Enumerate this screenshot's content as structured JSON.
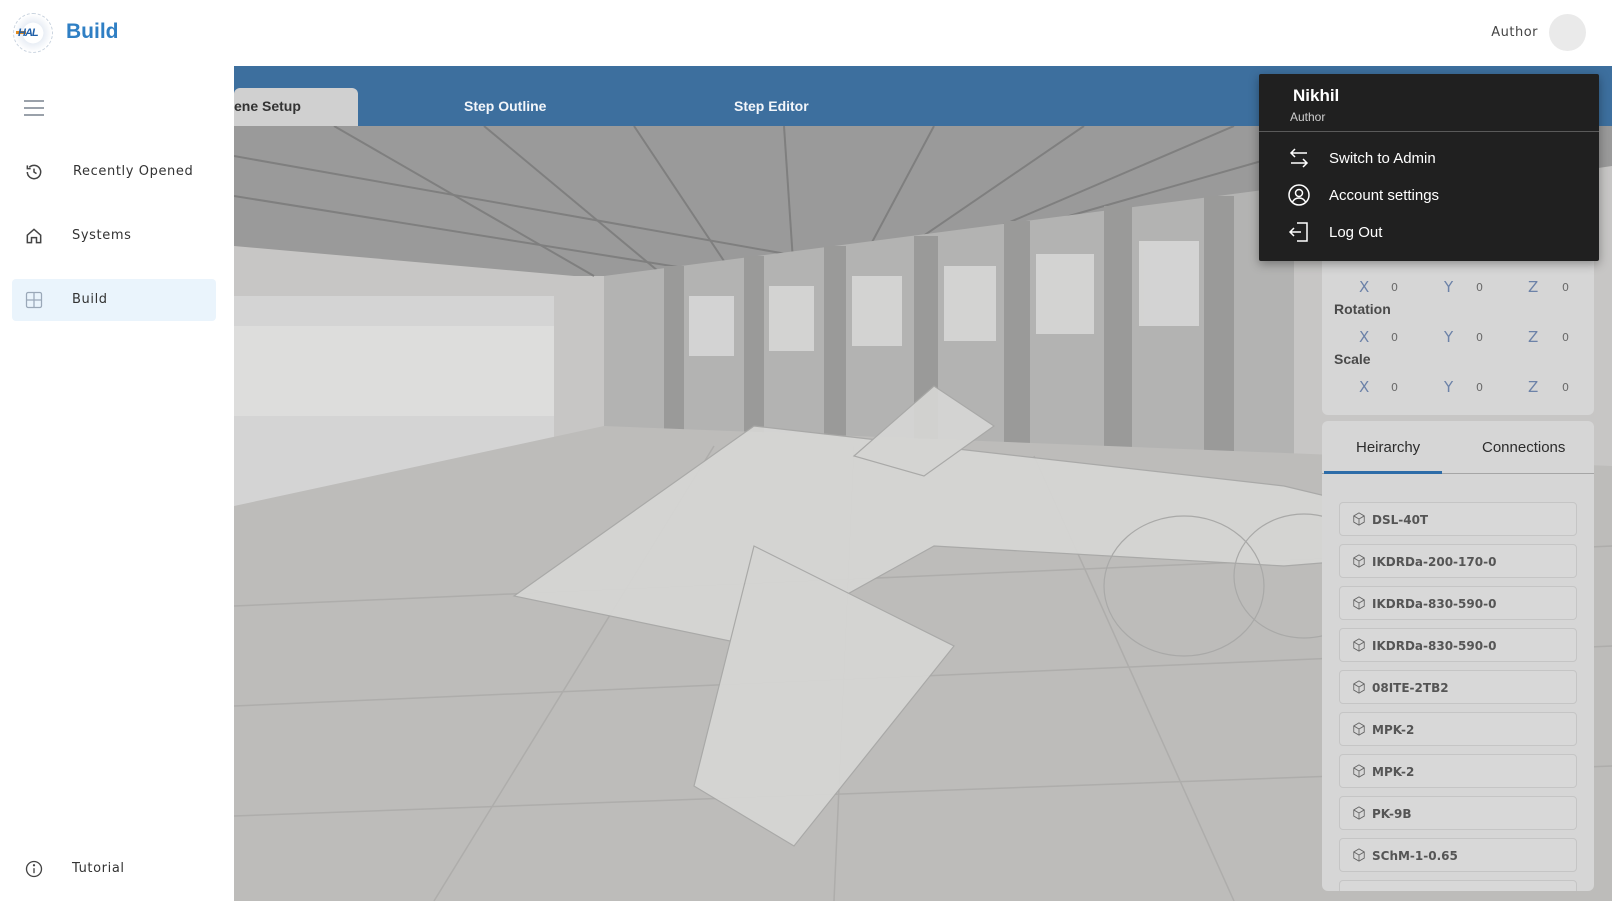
{
  "header": {
    "app_title": "Build",
    "role_label": "Author"
  },
  "sidebar": {
    "items": [
      {
        "label": "Recently Opened",
        "icon": "history-icon"
      },
      {
        "label": "Systems",
        "icon": "home-icon"
      },
      {
        "label": "Build",
        "icon": "grid-icon",
        "active": true
      }
    ],
    "footer_item": {
      "label": "Tutorial",
      "icon": "info-icon"
    }
  },
  "tabs": [
    {
      "label": "ene Setup",
      "active": true
    },
    {
      "label": "Step Outline"
    },
    {
      "label": "Step Editor"
    }
  ],
  "properties": {
    "sections": [
      {
        "label": "Rotation"
      },
      {
        "label": "Scale"
      }
    ],
    "axes": [
      "X",
      "Y",
      "Z"
    ],
    "values": {
      "position": [
        "0",
        "0",
        "0"
      ],
      "rotation": [
        "0",
        "0",
        "0"
      ],
      "scale": [
        "0",
        "0",
        "0"
      ]
    }
  },
  "hierarchy": {
    "tabs": [
      "Heirarchy",
      "Connections"
    ],
    "items": [
      "DSL-40T",
      "IKDRDa-200-170-0",
      "IKDRDa-830-590-0",
      "IKDRDa-830-590-0",
      "08ITE-2TB2",
      "MPK-2",
      "MPK-2",
      "PK-9B",
      "SChM-1-0.65"
    ]
  },
  "user_menu": {
    "name": "Nikhil",
    "role": "Author",
    "items": [
      {
        "label": "Switch to Admin",
        "icon": "switch-arrows-icon"
      },
      {
        "label": "Account settings",
        "icon": "account-circle-icon"
      },
      {
        "label": "Log Out",
        "icon": "logout-icon"
      }
    ]
  },
  "colors": {
    "accent": "#2f7fc4",
    "tab_bar": "#3d6f9e",
    "dropdown_bg": "#202020",
    "active_nav_bg": "#eaf4fc"
  }
}
